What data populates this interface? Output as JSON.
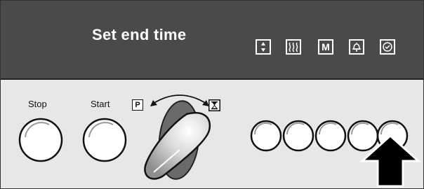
{
  "display": {
    "text": "Set end time",
    "buttons": [
      {
        "icon": "up-down-arrows-icon"
      },
      {
        "icon": "rapid-heat-icon"
      },
      {
        "icon": "M",
        "label": "M"
      },
      {
        "icon": "bell-icon"
      },
      {
        "icon": "clock-icon"
      }
    ]
  },
  "controls": {
    "stop_label": "Stop",
    "start_label": "Start",
    "program_label": "P",
    "timer_icon": "hourglass-icon"
  },
  "function_buttons_count": 5,
  "highlighted_button": 5,
  "colors": {
    "display_background": "#4a4a4a",
    "panel_background": "#e7e7e7",
    "text": "#ffffff"
  }
}
